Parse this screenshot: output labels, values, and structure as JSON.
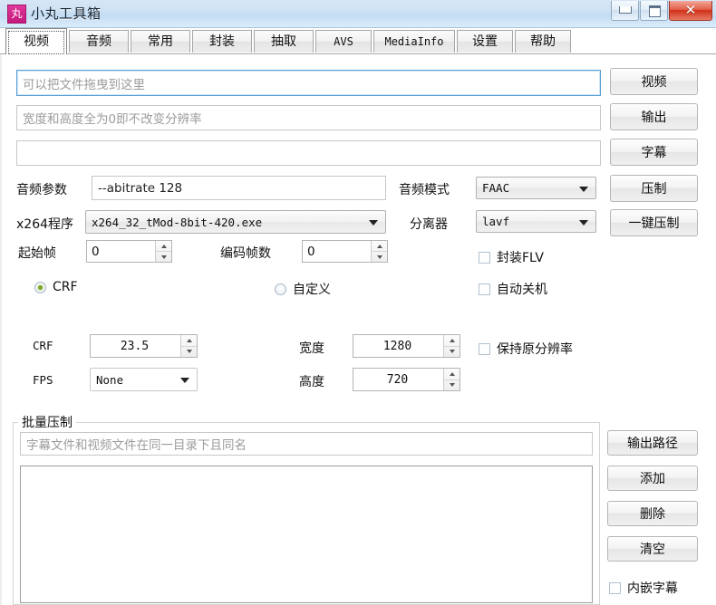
{
  "window": {
    "title": "小丸工具箱",
    "icon_glyph": "丸",
    "controls": {
      "minimize": "–",
      "maximize": "□",
      "close": "✕"
    }
  },
  "tabs": [
    {
      "label": "视频",
      "active": true,
      "latin": false
    },
    {
      "label": "音频",
      "active": false,
      "latin": false
    },
    {
      "label": "常用",
      "active": false,
      "latin": false
    },
    {
      "label": "封装",
      "active": false,
      "latin": false
    },
    {
      "label": "抽取",
      "active": false,
      "latin": false
    },
    {
      "label": "AVS",
      "active": false,
      "latin": true
    },
    {
      "label": "MediaInfo",
      "active": false,
      "latin": true
    },
    {
      "label": "设置",
      "active": false,
      "latin": false
    },
    {
      "label": "帮助",
      "active": false,
      "latin": false
    }
  ],
  "video_tab": {
    "input_video": {
      "value": "",
      "placeholder": "可以把文件拖曳到这里"
    },
    "input_output": {
      "value": "",
      "placeholder": "宽度和高度全为0即不改变分辨率"
    },
    "input_subtitle": {
      "value": "",
      "placeholder": ""
    },
    "side_buttons": [
      {
        "label": "视频"
      },
      {
        "label": "输出"
      },
      {
        "label": "字幕"
      },
      {
        "label": "压制"
      },
      {
        "label": "一键压制"
      }
    ],
    "audio_params": {
      "label": "音频参数",
      "value": "--abitrate 128"
    },
    "audio_mode": {
      "label": "音频模式",
      "value": "FAAC"
    },
    "x264_program": {
      "label": "x264程序",
      "value": "x264_32_tMod-8bit-420.exe"
    },
    "demuxer": {
      "label": "分离器",
      "value": "lavf"
    },
    "start_frame": {
      "label": "起始帧",
      "value": "0"
    },
    "frame_count": {
      "label": "编码帧数",
      "value": "0"
    },
    "mode_crf": {
      "label": "CRF",
      "selected": true
    },
    "mode_custom": {
      "label": "自定义",
      "selected": false
    },
    "chk_mux_flv": {
      "label": "封装FLV",
      "checked": false
    },
    "chk_auto_shutdown": {
      "label": "自动关机",
      "checked": false
    },
    "crf": {
      "label": "CRF",
      "value": "23.5"
    },
    "fps": {
      "label": "FPS",
      "value": "None"
    },
    "width": {
      "label": "宽度",
      "value": "1280"
    },
    "height": {
      "label": "高度",
      "value": "720"
    },
    "chk_keep_resolution": {
      "label": "保持原分辨率",
      "checked": false
    }
  },
  "batch": {
    "group_title": "批量压制",
    "path_input": {
      "value": "",
      "placeholder": "字幕文件和视频文件在同一目录下且同名"
    },
    "list_items": [],
    "buttons": [
      {
        "label": "输出路径"
      },
      {
        "label": "添加"
      },
      {
        "label": "删除"
      },
      {
        "label": "清空"
      }
    ],
    "chk_embed_subtitle": {
      "label": "内嵌字幕",
      "checked": false
    }
  },
  "colors": {
    "titlebar_start": "#d6e6f5",
    "titlebar_end": "#dbecfb",
    "close_button": "#cf3118",
    "app_icon": "#d02a8e",
    "radio_dot": "#7ba428",
    "focus_border": "#5a9fd4",
    "placeholder_text": "#9c9c9c"
  }
}
